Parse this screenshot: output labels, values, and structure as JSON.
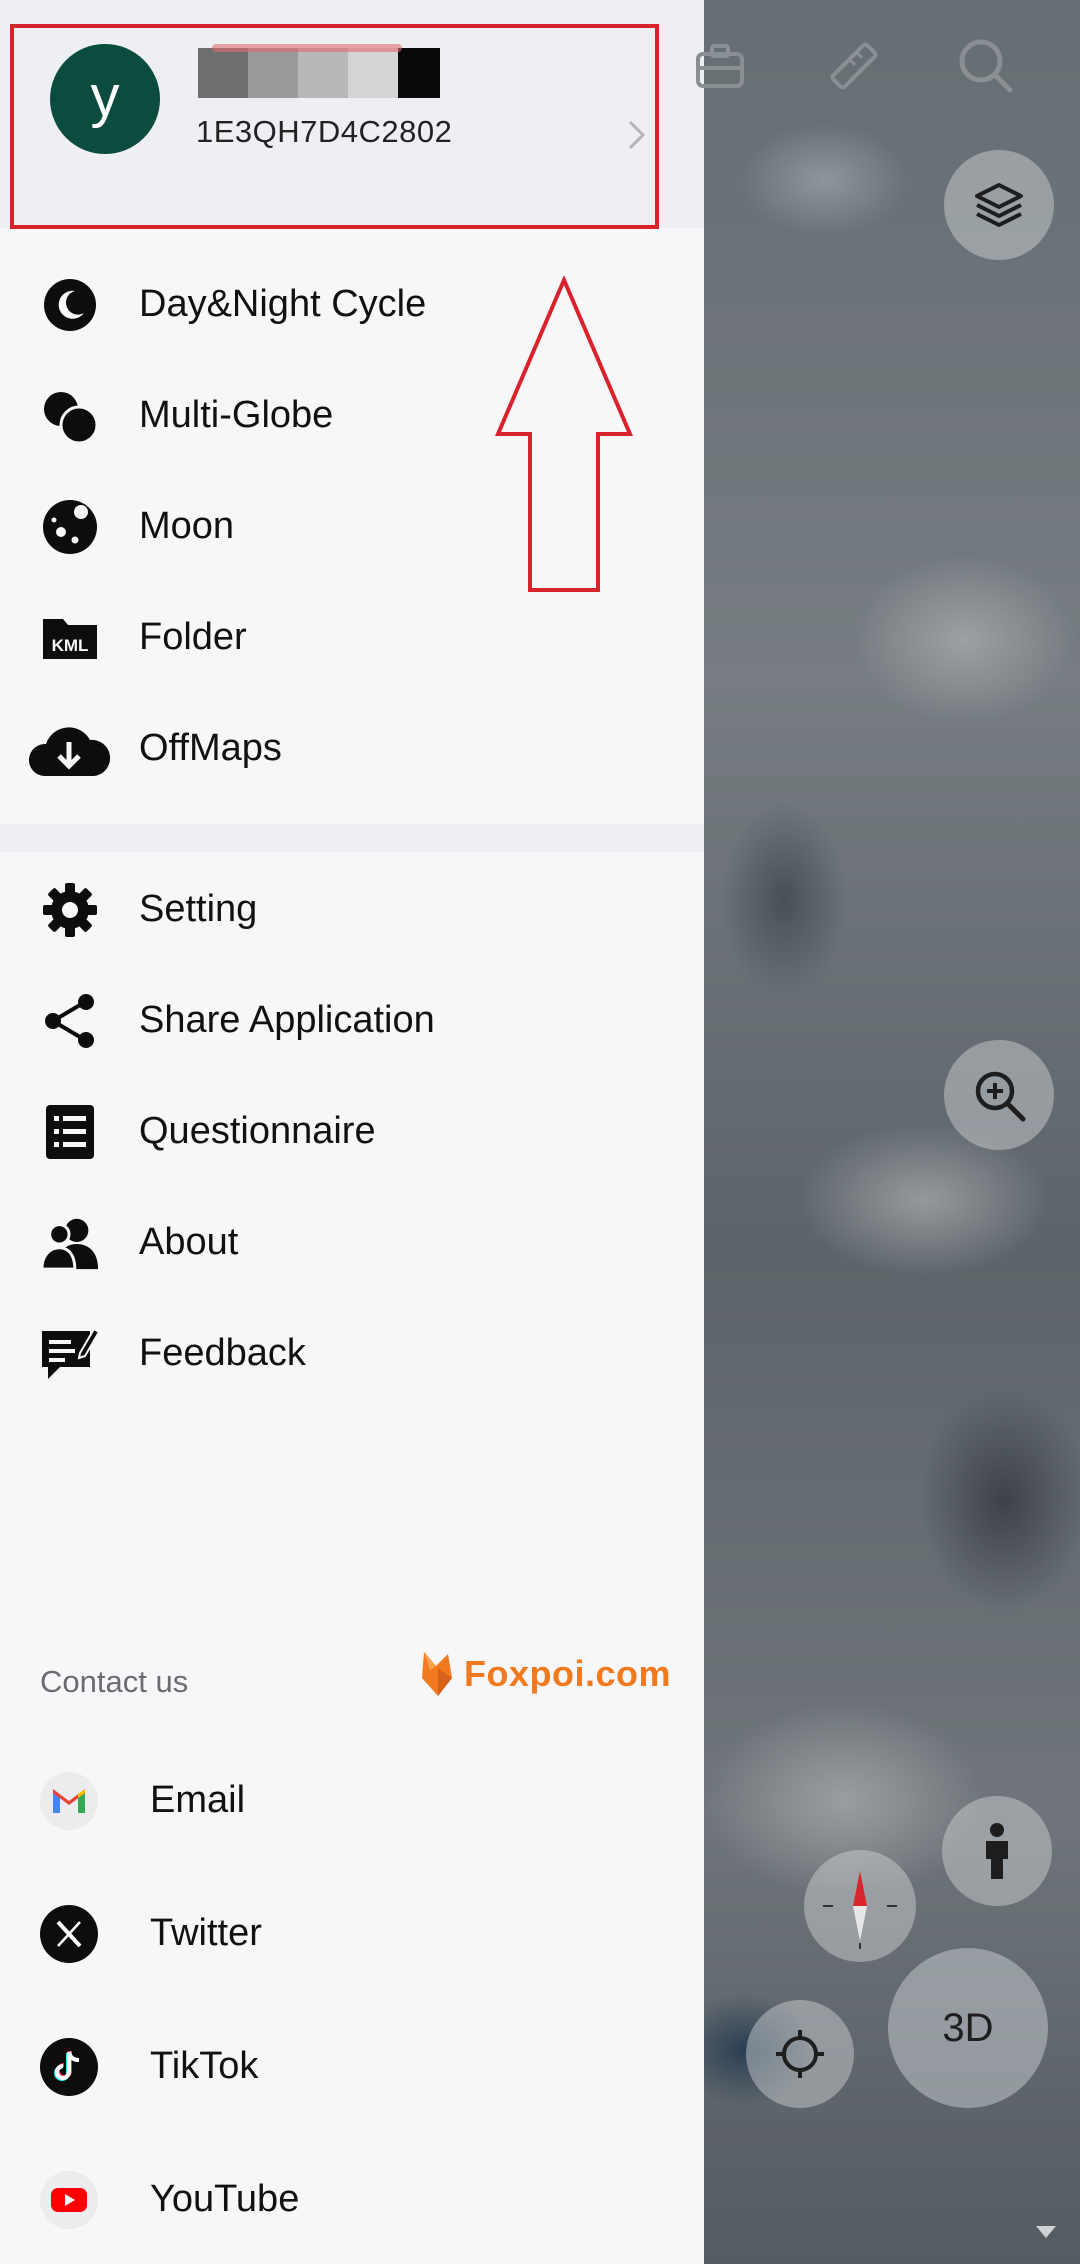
{
  "profile": {
    "avatar_letter": "y",
    "user_id": "1E3QH7D4C2802"
  },
  "menu_primary": [
    {
      "label": "Day&Night Cycle",
      "icon": "moon-crescent-icon"
    },
    {
      "label": "Multi-Globe",
      "icon": "multi-globe-icon"
    },
    {
      "label": "Moon",
      "icon": "moon-icon"
    },
    {
      "label": "Folder",
      "icon": "kml-folder-icon"
    },
    {
      "label": "OffMaps",
      "icon": "cloud-download-icon"
    }
  ],
  "menu_secondary": [
    {
      "label": "Setting",
      "icon": "gear-icon"
    },
    {
      "label": "Share Application",
      "icon": "share-icon"
    },
    {
      "label": "Questionnaire",
      "icon": "list-icon"
    },
    {
      "label": "About",
      "icon": "people-icon"
    },
    {
      "label": "Feedback",
      "icon": "feedback-icon"
    }
  ],
  "contact": {
    "title": "Contact us",
    "brand": "Foxpoi.com",
    "items": [
      {
        "label": "Email",
        "icon": "gmail-icon"
      },
      {
        "label": "Twitter",
        "icon": "x-icon"
      },
      {
        "label": "TikTok",
        "icon": "tiktok-icon"
      },
      {
        "label": "YouTube",
        "icon": "youtube-icon"
      }
    ]
  },
  "map_controls": {
    "mode_label": "3D"
  },
  "colors": {
    "highlight": "#d8222c",
    "avatar_bg": "#0b4c3f",
    "brand": "#f07a1d"
  }
}
